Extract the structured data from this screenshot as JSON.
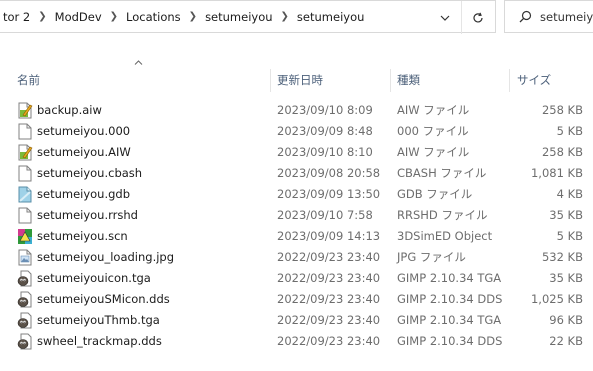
{
  "address": {
    "crumbs": [
      "tor 2",
      "ModDev",
      "Locations",
      "setumeiyou",
      "setumeiyou"
    ]
  },
  "search": {
    "placeholder": "setumeiyou"
  },
  "columns": {
    "name": "名前",
    "date": "更新日時",
    "type": "種類",
    "size": "サイズ"
  },
  "files": [
    {
      "name": "backup.aiw",
      "date": "2023/09/10 8:09",
      "type": "AIW ファイル",
      "size": "258 KB",
      "icon": "aiw-file-icon"
    },
    {
      "name": "setumeiyou.000",
      "date": "2023/09/09 8:48",
      "type": "000 ファイル",
      "size": "5 KB",
      "icon": "generic-file-icon"
    },
    {
      "name": "setumeiyou.AIW",
      "date": "2023/09/10 8:10",
      "type": "AIW ファイル",
      "size": "258 KB",
      "icon": "aiw-file-icon"
    },
    {
      "name": "setumeiyou.cbash",
      "date": "2023/09/08 20:58",
      "type": "CBASH ファイル",
      "size": "1,081 KB",
      "icon": "generic-file-icon"
    },
    {
      "name": "setumeiyou.gdb",
      "date": "2023/09/09 13:50",
      "type": "GDB ファイル",
      "size": "4 KB",
      "icon": "gdb-file-icon"
    },
    {
      "name": "setumeiyou.rrshd",
      "date": "2023/09/10 7:58",
      "type": "RRSHD ファイル",
      "size": "35 KB",
      "icon": "generic-file-icon"
    },
    {
      "name": "setumeiyou.scn",
      "date": "2023/09/09 14:13",
      "type": "3DSimED Object",
      "size": "5 KB",
      "icon": "scn-file-icon"
    },
    {
      "name": "setumeiyou_loading.jpg",
      "date": "2022/09/23 23:40",
      "type": "JPG ファイル",
      "size": "532 KB",
      "icon": "jpg-file-icon"
    },
    {
      "name": "setumeiyouicon.tga",
      "date": "2022/09/23 23:40",
      "type": "GIMP 2.10.34 TGA",
      "size": "35 KB",
      "icon": "gimp-file-icon"
    },
    {
      "name": "setumeiyouSMicon.dds",
      "date": "2022/09/23 23:40",
      "type": "GIMP 2.10.34 DDS",
      "size": "1,025 KB",
      "icon": "gimp-file-icon"
    },
    {
      "name": "setumeiyouThmb.tga",
      "date": "2022/09/23 23:40",
      "type": "GIMP 2.10.34 TGA",
      "size": "96 KB",
      "icon": "gimp-file-icon"
    },
    {
      "name": "swheel_trackmap.dds",
      "date": "2022/09/23 23:40",
      "type": "GIMP 2.10.34 DDS",
      "size": "22 KB",
      "icon": "gimp-file-icon"
    }
  ]
}
